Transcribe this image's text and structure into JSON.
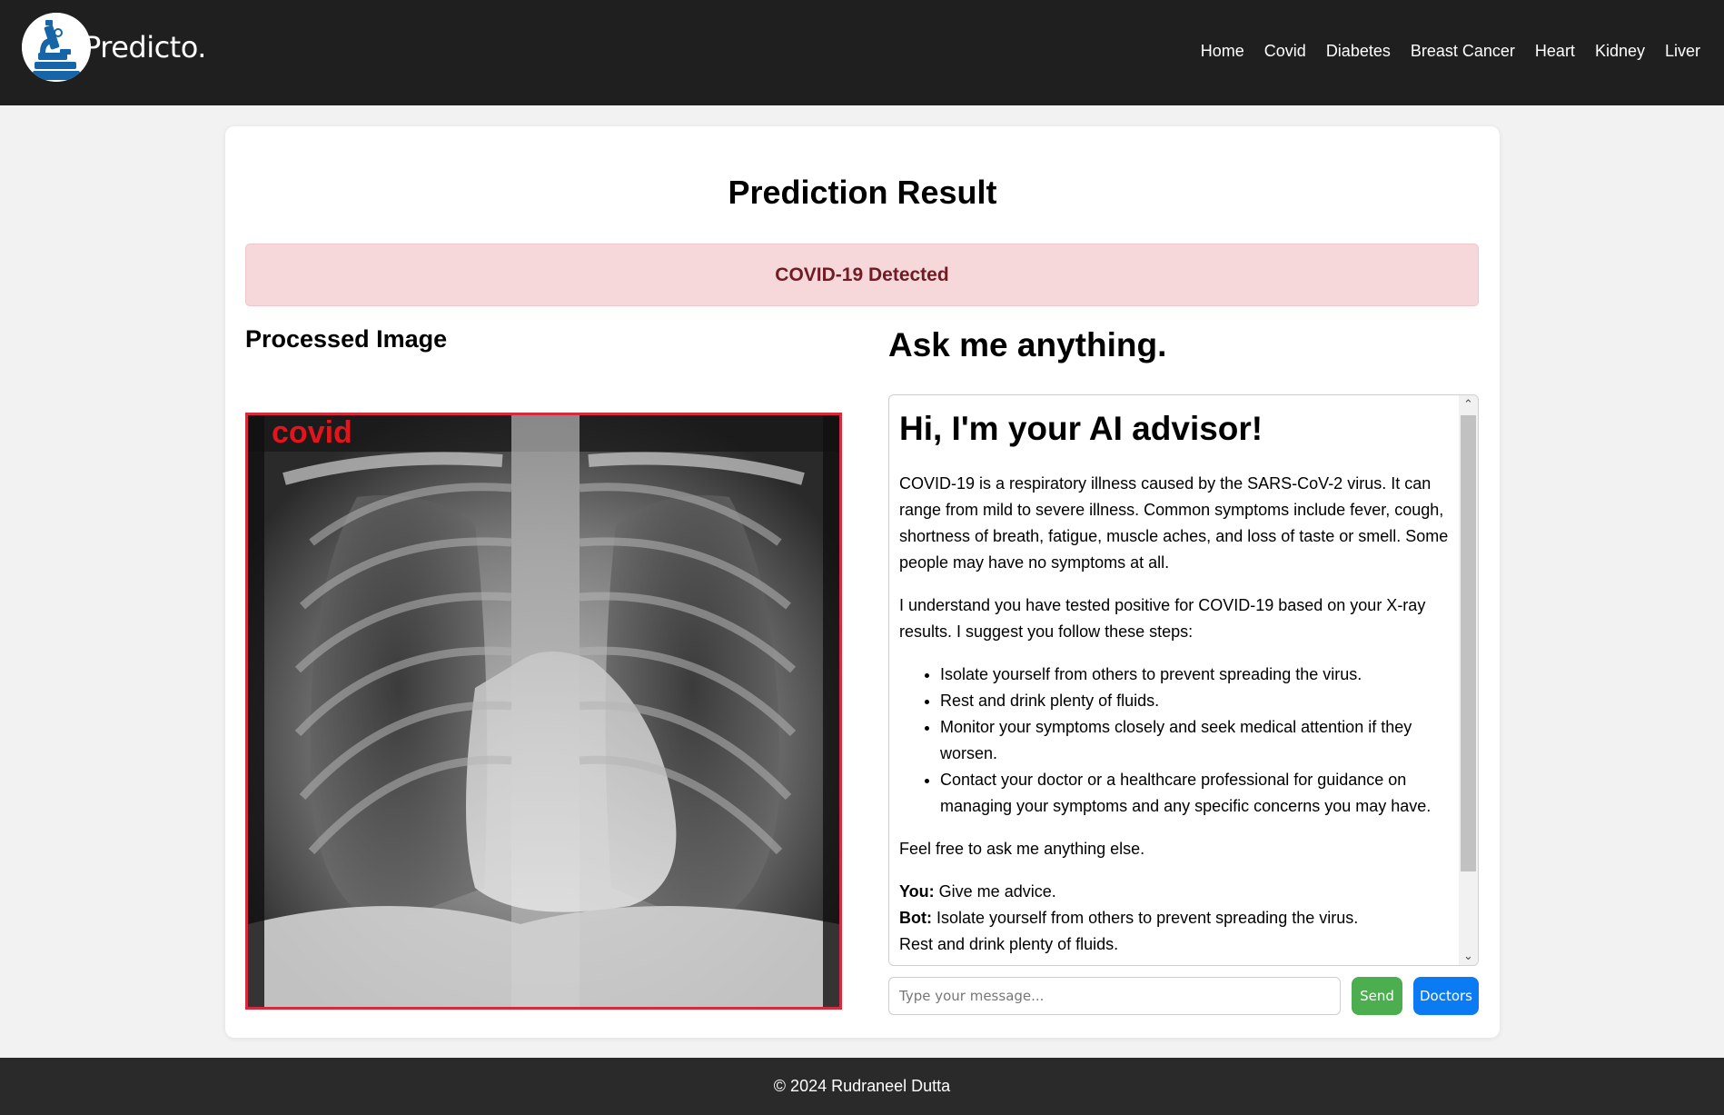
{
  "header": {
    "brand": "Predicto.",
    "nav": [
      "Home",
      "Covid",
      "Diabetes",
      "Breast Cancer",
      "Heart",
      "Kidney",
      "Liver"
    ]
  },
  "main": {
    "title": "Prediction Result",
    "alert": "COVID-19 Detected",
    "processed_title": "Processed Image",
    "image_label": "covid"
  },
  "chat": {
    "title": "Ask me anything.",
    "heading": "Hi, I'm your AI advisor!",
    "intro": "COVID-19 is a respiratory illness caused by the SARS-CoV-2 virus. It can range from mild to severe illness. Common symptoms include fever, cough, shortness of breath, fatigue, muscle aches, and loss of taste or smell. Some people may have no symptoms at all.",
    "advice_intro": "I understand you have tested positive for COVID-19 based on your X-ray results. I suggest you follow these steps:",
    "steps": [
      "Isolate yourself from others to prevent spreading the virus.",
      "Rest and drink plenty of fluids.",
      "Monitor your symptoms closely and seek medical attention if they worsen.",
      "Contact your doctor or a healthcare professional for guidance on managing your symptoms and any specific concerns you may have."
    ],
    "closing": "Feel free to ask me anything else.",
    "you_label": "You:",
    "you_msg": "Give me advice.",
    "bot_label": "Bot:",
    "bot_msg": "Isolate yourself from others to prevent spreading the virus.",
    "bot_msg_2": "Rest and drink plenty of fluids.",
    "input_placeholder": "Type your message...",
    "send_label": "Send",
    "doctors_label": "Doctors"
  },
  "footer": {
    "text": "© 2024 Rudraneel Dutta"
  },
  "colors": {
    "navbar": "#1f1f1f",
    "alert_bg": "#f6d7da",
    "alert_text": "#6f1c24",
    "image_border": "#d62b3c",
    "send": "#4cae4f",
    "doctors": "#0b7bf3"
  }
}
